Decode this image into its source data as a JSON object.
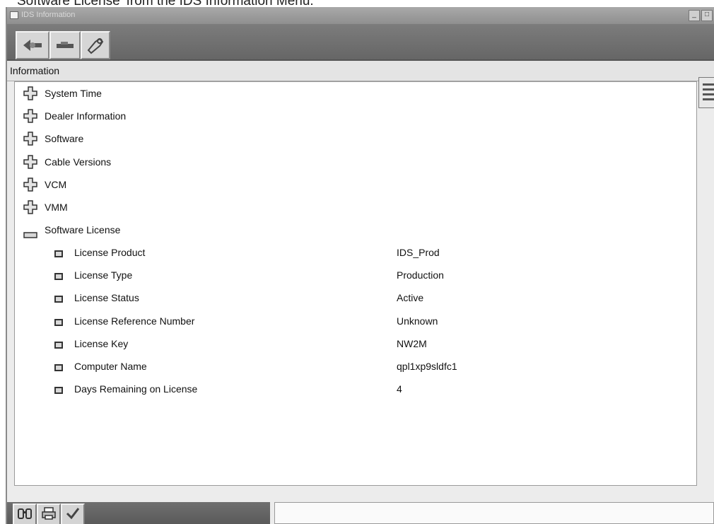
{
  "caption": "Software License' from the IDS Information Menu.",
  "window": {
    "title": "IDS Information"
  },
  "toolbar": {
    "buttons": [
      {
        "icon": "back-arrow-icon"
      },
      {
        "icon": "vehicle-icon"
      },
      {
        "icon": "tools-icon"
      }
    ]
  },
  "section": {
    "title": "Information"
  },
  "tree": {
    "collapsed": [
      {
        "label": "System Time"
      },
      {
        "label": "Dealer Information"
      },
      {
        "label": "Software"
      },
      {
        "label": "Cable Versions"
      },
      {
        "label": "VCM"
      },
      {
        "label": "VMM"
      }
    ],
    "expanded": {
      "label": "Software License",
      "children": [
        {
          "label": "License Product",
          "value": "IDS_Prod"
        },
        {
          "label": "License Type",
          "value": "Production"
        },
        {
          "label": "License Status",
          "value": "Active"
        },
        {
          "label": "License Reference Number",
          "value": "Unknown"
        },
        {
          "label": "License Key",
          "value": "NW2M"
        },
        {
          "label": "Computer Name",
          "value": "qpl1xp9sldfc1"
        },
        {
          "label": "Days Remaining on License",
          "value": "4"
        }
      ]
    }
  },
  "statusbar": {
    "buttons": [
      {
        "icon": "binoculars-icon"
      },
      {
        "icon": "printer-icon"
      },
      {
        "icon": "check-icon"
      }
    ]
  }
}
